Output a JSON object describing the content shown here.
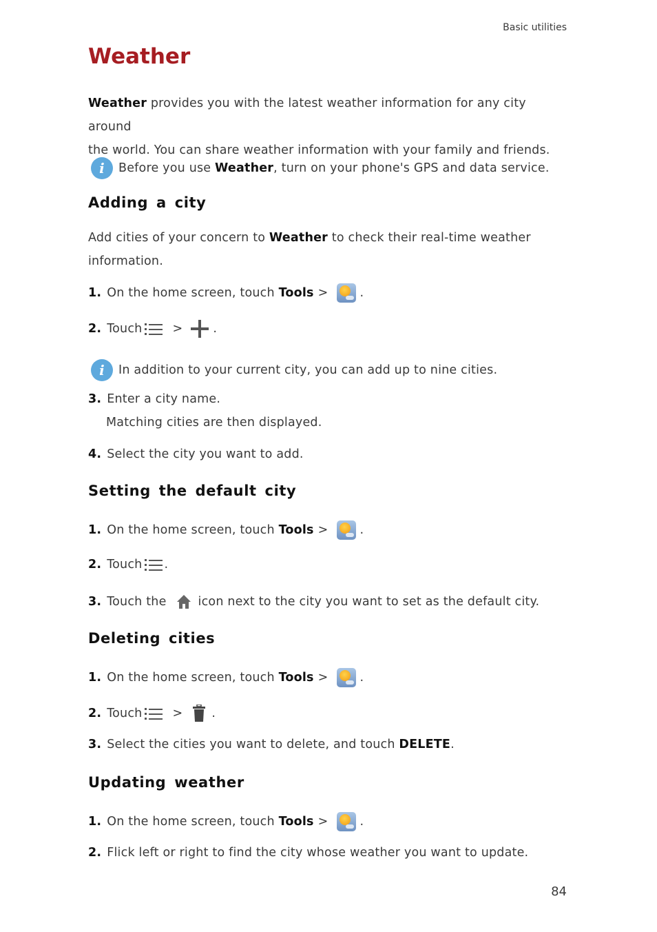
{
  "header": {
    "section": "Basic utilities"
  },
  "title": "Weather",
  "intro": {
    "bold": "Weather",
    "line1_rest": " provides you with the latest weather information for any city around",
    "line2": "the world. You can share weather information with your family and friends."
  },
  "note1": {
    "pre": "Before you use ",
    "bold": "Weather",
    "post": ", turn on your phone's GPS and data service.",
    "icon": "info-icon"
  },
  "sections": {
    "adding": {
      "heading": "Adding a city",
      "para_pre": "Add cities of your concern to ",
      "para_bold": "Weather",
      "para_post": " to check their real-time weather",
      "para_line2": "information.",
      "steps": [
        {
          "num": "1.",
          "text": "On the home screen, touch ",
          "bold": "Tools",
          "sep": ">",
          "icon": "weather-app-icon",
          "end": "."
        },
        {
          "num": "2.",
          "text": "Touch",
          "icon1": "menu-icon",
          "sep": ">",
          "icon2": "plus-icon",
          "end": "."
        },
        {
          "num": "3.",
          "text": "Enter a city name.",
          "sub": "Matching cities are then displayed."
        },
        {
          "num": "4.",
          "text": "Select the city you want to add."
        }
      ],
      "note": {
        "text": "In addition to your current city, you can add up to nine cities.",
        "icon": "info-icon"
      }
    },
    "default": {
      "heading": "Setting the default city",
      "steps": [
        {
          "num": "1.",
          "text": "On the home screen, touch ",
          "bold": "Tools",
          "sep": ">",
          "icon": "weather-app-icon",
          "end": "."
        },
        {
          "num": "2.",
          "text": "Touch",
          "icon": "menu-icon",
          "end": "."
        },
        {
          "num": "3.",
          "pre": "Touch the",
          "icon": "home-icon",
          "post": "icon next to the city you want to set as the default city."
        }
      ]
    },
    "deleting": {
      "heading": "Deleting cities",
      "steps": [
        {
          "num": "1.",
          "text": "On the home screen, touch ",
          "bold": "Tools",
          "sep": ">",
          "icon": "weather-app-icon",
          "end": "."
        },
        {
          "num": "2.",
          "text": "Touch",
          "icon1": "menu-icon",
          "sep": ">",
          "icon2": "trash-icon",
          "end": "."
        },
        {
          "num": "3.",
          "text": "Select the cities you want to delete, and touch ",
          "bold": "DELETE",
          "end": "."
        }
      ]
    },
    "updating": {
      "heading": "Updating weather",
      "steps": [
        {
          "num": "1.",
          "text": "On the home screen, touch ",
          "bold": "Tools",
          "sep": ">",
          "icon": "weather-app-icon",
          "end": "."
        },
        {
          "num": "2.",
          "text": "Flick left or right to find the city whose weather you want to update."
        }
      ]
    }
  },
  "page_number": "84",
  "colors": {
    "title": "#a61d22",
    "info_icon": "#5ea9dd",
    "body_text": "#3a3a3a"
  }
}
